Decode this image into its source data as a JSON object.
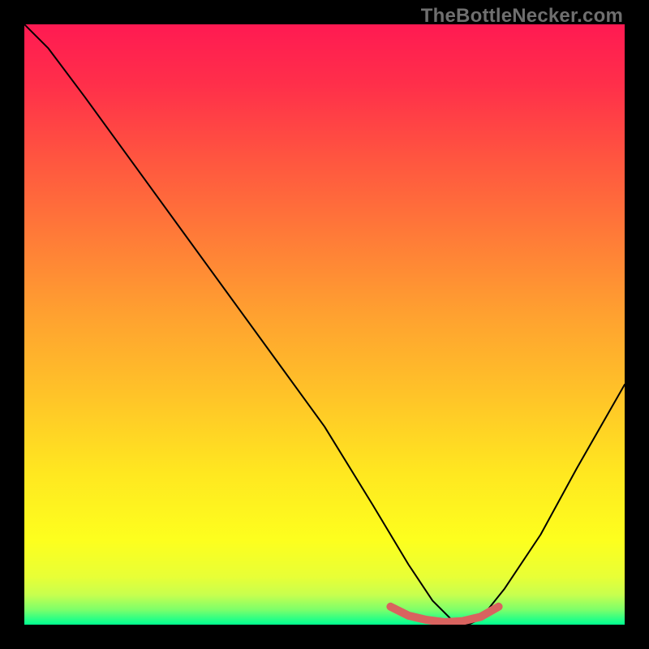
{
  "watermark": "TheBottleNecker.com",
  "chart_data": {
    "type": "line",
    "title": "",
    "xlabel": "",
    "ylabel": "",
    "xlim": [
      0,
      100
    ],
    "ylim": [
      0,
      100
    ],
    "grid": false,
    "legend": false,
    "series": [
      {
        "name": "bottleneck-curve",
        "x": [
          0,
          4,
          10,
          18,
          26,
          34,
          42,
          50,
          58,
          64,
          68,
          71,
          74,
          76,
          80,
          86,
          92,
          100
        ],
        "values": [
          100,
          96,
          88,
          77,
          66,
          55,
          44,
          33,
          20,
          10,
          4,
          1,
          0,
          1,
          6,
          15,
          26,
          40
        ]
      }
    ],
    "highlight": {
      "name": "valley-marker",
      "color": "#d9635f",
      "x": [
        61,
        64,
        67,
        70,
        73,
        76,
        79
      ],
      "values": [
        3,
        1.5,
        0.8,
        0.4,
        0.6,
        1.3,
        3
      ]
    },
    "background_gradient": {
      "top": "#ff1a52",
      "mid_upper": "#ff7a38",
      "mid_lower": "#ffe820",
      "bottom": "#00ff90"
    }
  }
}
